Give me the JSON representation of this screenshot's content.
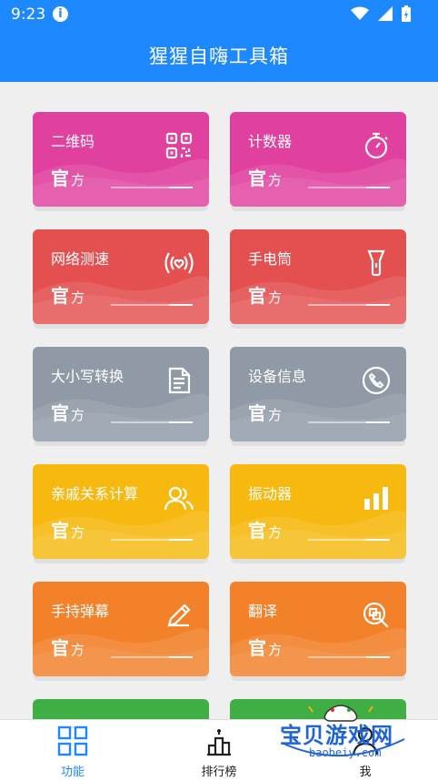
{
  "status_bar": {
    "time": "9:23",
    "info_glyph": "i"
  },
  "app_bar": {
    "title": "猩猩自嗨工具箱"
  },
  "badge": {
    "big": "官",
    "small": "方"
  },
  "cards": [
    {
      "label": "二维码",
      "icon": "qr-code-icon",
      "color": "#e0409e"
    },
    {
      "label": "计数器",
      "icon": "stopwatch-icon",
      "color": "#e0409e"
    },
    {
      "label": "网络测速",
      "icon": "signal-broadcast-icon",
      "color": "#e45050"
    },
    {
      "label": "手电筒",
      "icon": "flashlight-icon",
      "color": "#e45050"
    },
    {
      "label": "大小写转换",
      "icon": "document-icon",
      "color": "#8f9aa6"
    },
    {
      "label": "设备信息",
      "icon": "phone-icon",
      "color": "#8f9aa6"
    },
    {
      "label": "亲戚关系计算",
      "icon": "people-icon",
      "color": "#f7b910"
    },
    {
      "label": "振动器",
      "icon": "bar-chart-icon",
      "color": "#f7b910"
    },
    {
      "label": "手持弹幕",
      "icon": "pencil-icon",
      "color": "#f2812a"
    },
    {
      "label": "翻译",
      "icon": "translate-icon",
      "color": "#f2812a"
    }
  ],
  "bottom_nav": {
    "items": [
      {
        "label": "功能",
        "icon": "grid-icon",
        "active": true
      },
      {
        "label": "排行榜",
        "icon": "podium-icon",
        "active": false
      },
      {
        "label": "我",
        "icon": "user-icon",
        "active": false
      }
    ],
    "active_color": "#1e88ff"
  },
  "watermark": {
    "text": "宝贝游戏网",
    "url": "baobeiy.com"
  }
}
